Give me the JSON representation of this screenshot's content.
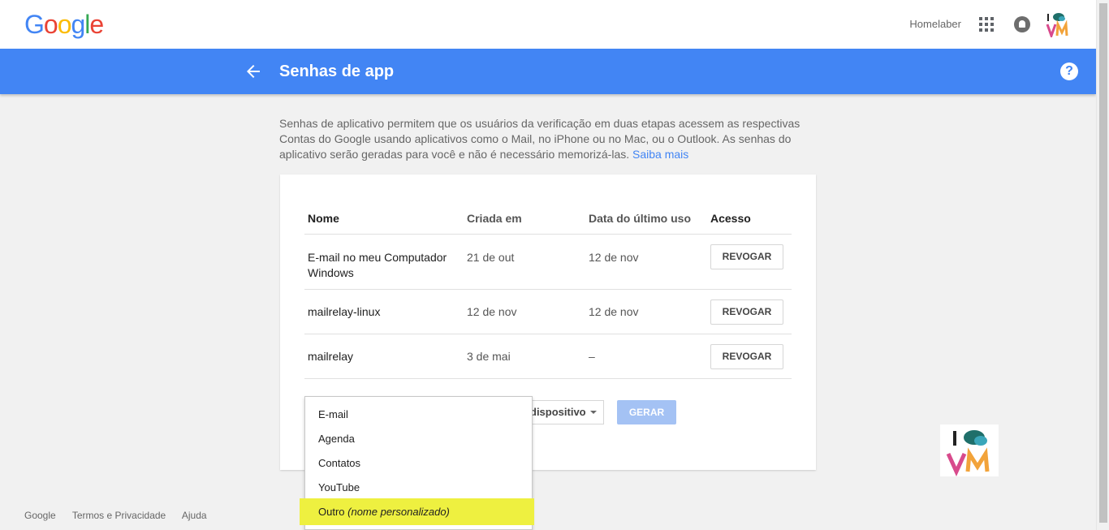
{
  "header": {
    "logo_letters": [
      {
        "ch": "G",
        "color": "#4285f4"
      },
      {
        "ch": "o",
        "color": "#ea4335"
      },
      {
        "ch": "o",
        "color": "#fbbc05"
      },
      {
        "ch": "g",
        "color": "#4285f4"
      },
      {
        "ch": "l",
        "color": "#34a853"
      },
      {
        "ch": "e",
        "color": "#ea4335"
      }
    ],
    "account_name": "Homelaber"
  },
  "titlebar": {
    "title": "Senhas de app",
    "help": "?"
  },
  "description": {
    "text": "Senhas de aplicativo permitem que os usuários da verificação em duas etapas acessem as respectivas Contas do Google usando aplicativos como o Mail, no iPhone ou no Mac, ou o Outlook. As senhas do aplicativo serão geradas para você e não é necessário memorizá-las.",
    "link": "Saiba mais"
  },
  "table": {
    "headers": [
      "Nome",
      "Criada em",
      "Data do último uso",
      "Acesso"
    ],
    "rows": [
      {
        "name": "E-mail no meu Computador Windows",
        "created": "21 de out",
        "last_used": "12 de nov",
        "action": "REVOGAR"
      },
      {
        "name": "mailrelay-linux",
        "created": "12 de nov",
        "last_used": "12 de nov",
        "action": "REVOGAR"
      },
      {
        "name": "mailrelay",
        "created": "3 de mai",
        "last_used": "–",
        "action": "REVOGAR"
      }
    ]
  },
  "generator": {
    "device_select": "dispositivo",
    "generate_label": "GERAR"
  },
  "dropdown": {
    "items": [
      "E-mail",
      "Agenda",
      "Contatos",
      "YouTube"
    ],
    "other_label": "Outro",
    "other_hint": "(nome personalizado)"
  },
  "footer": {
    "links": [
      "Google",
      "Termos e Privacidade",
      "Ajuda"
    ]
  },
  "colors": {
    "accent": "#4285f4",
    "highlight": "#eef040"
  }
}
